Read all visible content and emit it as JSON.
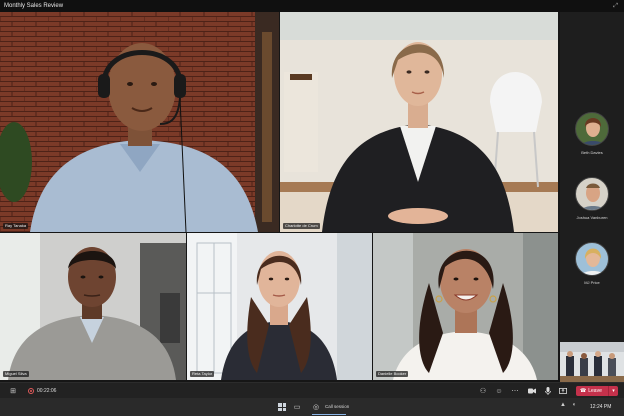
{
  "window": {
    "title": "Monthly Sales Review",
    "expand_icon": "expand-icon"
  },
  "participants": [
    {
      "name": "Ray Tanaka",
      "bg": "#7a3b28",
      "shirt": "#9fb4cc",
      "skin": "#8a5a3e"
    },
    {
      "name": "Charlotte de Crum",
      "bg": "#e9e4dc",
      "shirt": "#1f1f22",
      "skin": "#e0b79a"
    },
    {
      "name": "Miguel Silva",
      "bg": "#c9c9c9",
      "shirt": "#9a9a98",
      "skin": "#6e4431"
    },
    {
      "name": "Reta Taylor",
      "bg": "#e6e8ea",
      "shirt": "#2a2c35",
      "skin": "#e1b59a"
    },
    {
      "name": "Danielle Booker",
      "bg": "#b0b2ae",
      "shirt": "#f4f2ee",
      "skin": "#b98266"
    }
  ],
  "roster": [
    {
      "name": "Beth Davies"
    },
    {
      "name": "Joshua Vanburen"
    },
    {
      "name": "MJ Price"
    }
  ],
  "controls": {
    "timer": "00:22:06",
    "leave_label": "Leave",
    "leave_color": "#c4314b"
  },
  "taskbar": {
    "app_label": "Call session",
    "time": "12:24 PM"
  }
}
